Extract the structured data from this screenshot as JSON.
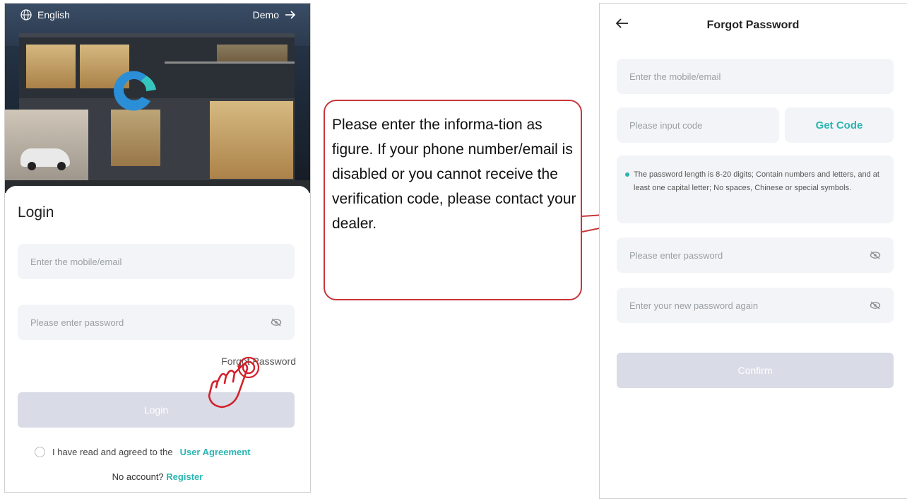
{
  "login_screen": {
    "language_label": "English",
    "demo_label": "Demo",
    "title": "Login",
    "account_placeholder": "Enter the mobile/email",
    "password_placeholder": "Please enter password",
    "forgot_password_link": "Forgot Password",
    "login_button": "Login",
    "agreement_text": "I have read and agreed to the",
    "agreement_link": "User Agreement",
    "no_account_text": "No account?",
    "register_link": "Register"
  },
  "callout": {
    "text": "Please enter the informa-tion as figure. If your phone number/email is disabled or you cannot receive the verification code, please contact your dealer."
  },
  "forgot_screen": {
    "title": "Forgot Password",
    "account_placeholder": "Enter the mobile/email",
    "code_placeholder": "Please input code",
    "get_code_button": "Get Code",
    "password_rule": "The password length is 8-20 digits; Contain numbers and letters, and at least one capital letter; No spaces, Chinese or special symbols.",
    "new_password_placeholder": "Please enter password",
    "confirm_password_placeholder": "Enter your new password again",
    "confirm_button": "Confirm"
  },
  "colors": {
    "accent": "#2bb5b1",
    "disabled_button": "#d9dbe6",
    "callout_border": "#c8363a",
    "input_background": "#f3f4f7"
  },
  "icons": [
    "globe-icon",
    "arrow-right-icon",
    "app-logo",
    "eye-off-icon",
    "tap-hand-icon",
    "back-arrow-icon"
  ]
}
